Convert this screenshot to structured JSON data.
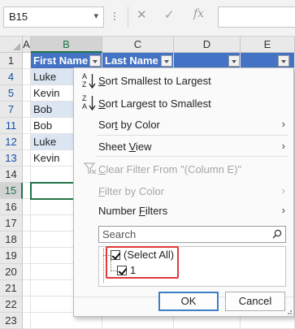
{
  "name_box": {
    "value": "B15",
    "dropdown_icon": "chevron-down-icon"
  },
  "formula_buttons": {
    "cancel": "✕",
    "enter": "✓",
    "function": "fx"
  },
  "columns": [
    "A",
    "B",
    "C",
    "D",
    "E"
  ],
  "selected_column": "B",
  "rows": [
    {
      "num": "1",
      "b": "First Name",
      "c": "Last Name",
      "filtered_row": false
    },
    {
      "num": "4",
      "b": "Luke",
      "c": "",
      "filtered_row": true
    },
    {
      "num": "5",
      "b": "Kevin",
      "c": "",
      "filtered_row": true
    },
    {
      "num": "7",
      "b": "Bob",
      "c": "",
      "filtered_row": true
    },
    {
      "num": "11",
      "b": "Bob",
      "c": "",
      "filtered_row": true
    },
    {
      "num": "12",
      "b": "Luke",
      "c": "",
      "filtered_row": true
    },
    {
      "num": "13",
      "b": "Kevin",
      "c": "",
      "filtered_row": true
    },
    {
      "num": "14",
      "b": "",
      "c": "",
      "filtered_row": false
    },
    {
      "num": "15",
      "b": "",
      "c": "",
      "filtered_row": false
    },
    {
      "num": "16",
      "b": "",
      "c": "",
      "filtered_row": false
    },
    {
      "num": "17",
      "b": "",
      "c": "",
      "filtered_row": false
    },
    {
      "num": "18",
      "b": "",
      "c": "",
      "filtered_row": false
    },
    {
      "num": "19",
      "b": "",
      "c": "",
      "filtered_row": false
    },
    {
      "num": "20",
      "b": "",
      "c": "",
      "filtered_row": false
    },
    {
      "num": "21",
      "b": "",
      "c": "",
      "filtered_row": false
    },
    {
      "num": "22",
      "b": "",
      "c": "",
      "filtered_row": false
    },
    {
      "num": "23",
      "b": "",
      "c": "",
      "filtered_row": false
    }
  ],
  "selected_row": "15",
  "filter_menu": {
    "sort_asc": {
      "pre": "",
      "key": "S",
      "post": "ort Smallest to Largest",
      "icon": "sort-a-z-icon"
    },
    "sort_desc": {
      "pre": "",
      "key": "S",
      "post": "ort Largest to Smallest",
      "icon": "sort-z-a-icon"
    },
    "sort_by_color": {
      "pre": "Sor",
      "key": "t",
      "post": " by Color"
    },
    "sheet_view": {
      "pre": "Sheet ",
      "key": "V",
      "post": "iew"
    },
    "clear_filter": {
      "pre": "",
      "key": "C",
      "post": "lear Filter From \"(Column E)\"",
      "icon": "clear-filter-icon"
    },
    "filter_by_color": {
      "pre": "",
      "key": "F",
      "post": "ilter by Color"
    },
    "number_filters": {
      "pre": "Number ",
      "key": "F",
      "post": "ilters"
    },
    "search_placeholder": "Search",
    "list_items": [
      {
        "label": "(Select All)",
        "checked": true
      },
      {
        "label": "1",
        "checked": true
      }
    ],
    "ok_label": "OK",
    "cancel_label": "Cancel"
  },
  "colors": {
    "header_fill": "#4472c4",
    "band_fill": "#dce6f3",
    "excel_green": "#217346",
    "highlight_red": "#e03a3a",
    "filtered_row_number": "#0f51a6"
  }
}
